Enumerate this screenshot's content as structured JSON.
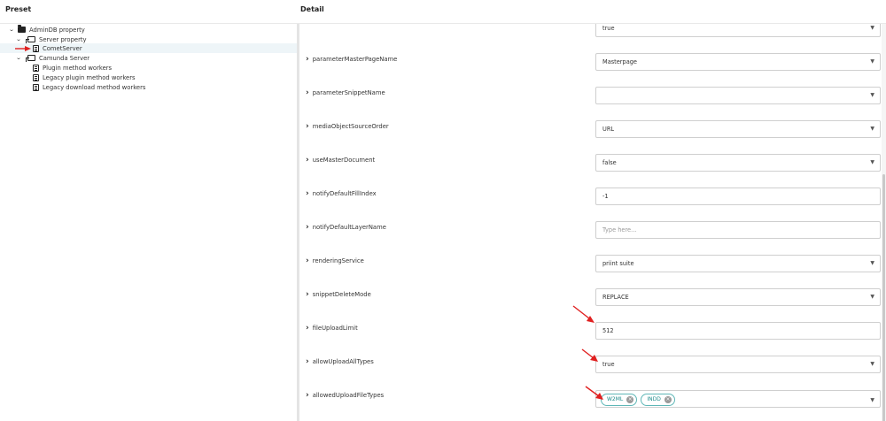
{
  "headers": {
    "preset": "Preset",
    "detail": "Detail"
  },
  "tree": [
    {
      "label": "AdminDB property",
      "icon": "folder-icon",
      "expanded": true,
      "level": 0
    },
    {
      "label": "Server property",
      "icon": "server-icon",
      "expanded": true,
      "level": 1
    },
    {
      "label": "CometServer",
      "icon": "document-icon",
      "level": 2,
      "selected": true
    },
    {
      "label": "Camunda Server",
      "icon": "server-icon",
      "expanded": true,
      "level": 1
    },
    {
      "label": "Plugin method workers",
      "icon": "document-icon",
      "level": 2
    },
    {
      "label": "Legacy plugin method workers",
      "icon": "document-icon",
      "level": 2
    },
    {
      "label": "Legacy download method workers",
      "icon": "document-icon",
      "level": 2
    }
  ],
  "properties": [
    {
      "name": "",
      "type": "select",
      "value": "true"
    },
    {
      "name": "parameterMasterPageName",
      "type": "select",
      "value": "Masterpage"
    },
    {
      "name": "parameterSnippetName",
      "type": "select",
      "value": ""
    },
    {
      "name": "mediaObjectSourceOrder",
      "type": "select",
      "value": "URL"
    },
    {
      "name": "useMasterDocument",
      "type": "select",
      "value": "false"
    },
    {
      "name": "notifyDefaultFillIndex",
      "type": "input",
      "value": "-1"
    },
    {
      "name": "notifyDefaultLayerName",
      "type": "input",
      "value": "",
      "placeholder": "Type here..."
    },
    {
      "name": "renderingService",
      "type": "select",
      "value": "priint suite"
    },
    {
      "name": "snippetDeleteMode",
      "type": "select",
      "value": "REPLACE"
    },
    {
      "name": "fileUploadLimit",
      "type": "input",
      "value": "512"
    },
    {
      "name": "allowUploadAllTypes",
      "type": "select",
      "value": "true"
    },
    {
      "name": "allowedUploadFileTypes",
      "type": "multiselect",
      "chips": [
        "W2ML",
        "INDD"
      ]
    }
  ],
  "colors": {
    "annotation_arrow": "#e02020",
    "chip_accent": "#1f8c8c",
    "selected_row": "#eef5f8"
  },
  "icons": {
    "expand": "chevron-down-icon",
    "collapsed": "chevron-right-icon",
    "dropdown": "caret-down-icon",
    "chip_remove": "close-circle-icon"
  }
}
